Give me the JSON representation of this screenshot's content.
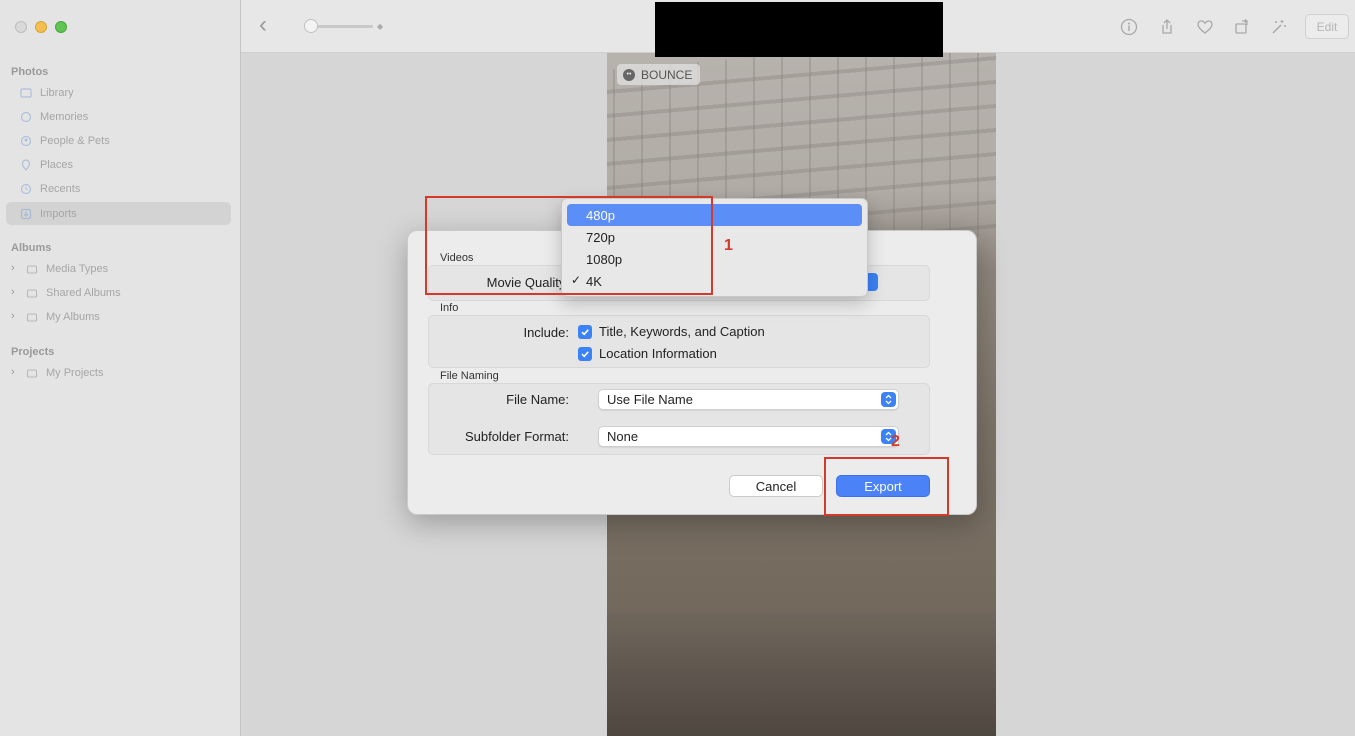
{
  "sidebar": {
    "sections": [
      {
        "label": "Photos",
        "items": [
          {
            "label": "Library",
            "icon": "library-icon"
          },
          {
            "label": "Memories",
            "icon": "memories-icon"
          },
          {
            "label": "People & Pets",
            "icon": "people-icon"
          },
          {
            "label": "Places",
            "icon": "places-icon"
          },
          {
            "label": "Recents",
            "icon": "recents-icon"
          },
          {
            "label": "Imports",
            "icon": "imports-icon",
            "selected": true
          }
        ]
      },
      {
        "label": "Albums",
        "items": [
          {
            "label": "Media Types",
            "icon": "folder-icon"
          },
          {
            "label": "Shared Albums",
            "icon": "shared-album-icon"
          },
          {
            "label": "My Albums",
            "icon": "folder-icon"
          }
        ]
      },
      {
        "label": "Projects",
        "items": [
          {
            "label": "My Projects",
            "icon": "folder-icon"
          }
        ]
      }
    ]
  },
  "toolbar": {
    "edit_label": "Edit",
    "icons": [
      "info-icon",
      "share-icon",
      "heart-icon",
      "rotate-icon",
      "magic-wand-icon"
    ]
  },
  "photo": {
    "badge_label": "BOUNCE"
  },
  "dialog": {
    "videos_label": "Videos",
    "movie_quality_label": "Movie Quality:",
    "info_label": "Info",
    "include_label": "Include:",
    "include_options": [
      {
        "label": "Title, Keywords, and Caption",
        "checked": true
      },
      {
        "label": "Location Information",
        "checked": true
      }
    ],
    "file_naming_label": "File Naming",
    "file_name_label": "File Name:",
    "file_name_value": "Use File Name",
    "subfolder_label": "Subfolder Format:",
    "subfolder_value": "None",
    "cancel_label": "Cancel",
    "export_label": "Export"
  },
  "quality_menu": {
    "options": [
      {
        "label": "480p",
        "highlighted": true,
        "checked": false
      },
      {
        "label": "720p",
        "highlighted": false,
        "checked": false
      },
      {
        "label": "1080p",
        "highlighted": false,
        "checked": false
      },
      {
        "label": "4K",
        "highlighted": false,
        "checked": true
      }
    ],
    "check_mark": "✓"
  },
  "annotations": {
    "step1": "1",
    "step2": "2"
  },
  "colors": {
    "accent": "#4c82f7",
    "annotation": "#d33a2c",
    "highlight": "#5b8ef7"
  }
}
